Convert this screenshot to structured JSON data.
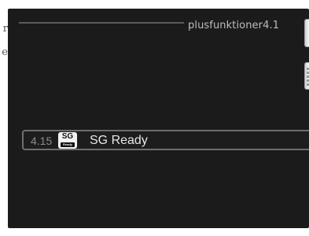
{
  "screen": {
    "menu_title": "plusfunktioner4.1"
  },
  "menu": {
    "items": [
      {
        "number": "4.15",
        "icon": "sg-ready-icon",
        "icon_text": "SG",
        "icon_subtext": "Ready",
        "label": "SG Ready",
        "selected": true
      }
    ]
  },
  "edge_text": {
    "glyphs": [
      "r",
      "e"
    ]
  },
  "colors": {
    "screen_background": "#1b1b1b",
    "title_text": "#bdbdbd",
    "row_border": "#6e6e6e",
    "label_text": "#e8e8e8",
    "number_text": "#8c8c8c"
  }
}
